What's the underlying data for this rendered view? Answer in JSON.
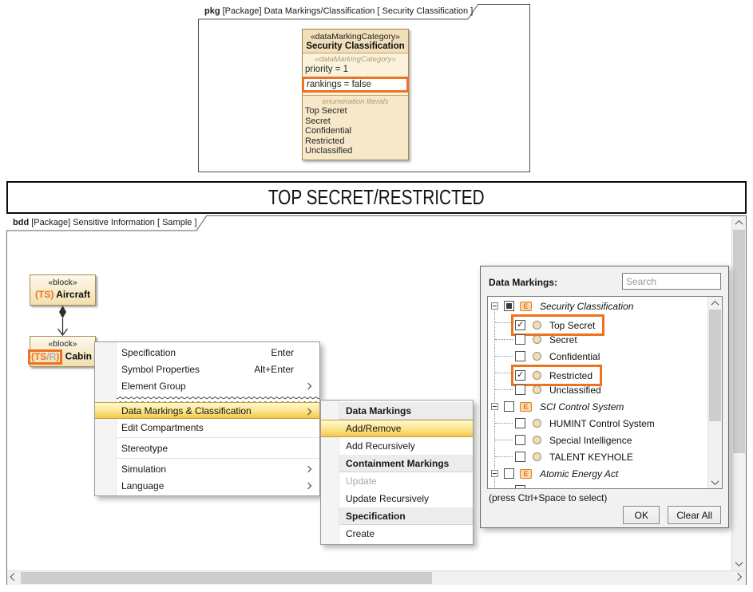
{
  "pkg_diagram": {
    "tab_kind": "pkg",
    "tab_title": "[Package] Data Markings/Classification [ Security Classification ]",
    "class_box": {
      "stereotype": "«dataMarkingCategory»",
      "name": "Security Classification",
      "section_stereotype": "«dataMarkingCategory»",
      "attribute_priority": "priority = 1",
      "attribute_rankings": "rankings = false",
      "literals_caption": "enumeration literals",
      "literals": [
        "Top Secret",
        "Secret",
        "Confidential",
        "Restricted",
        "Unclassified"
      ]
    }
  },
  "banner": {
    "text": "TOP SECRET/RESTRICTED"
  },
  "bdd_diagram": {
    "tab_kind": "bdd",
    "tab_title": "[Package] Sensitive Information [ Sample ]",
    "aircraft": {
      "stereotype": "«block»",
      "marking": "(TS)",
      "name": "Aircraft"
    },
    "cabin": {
      "stereotype": "«block»",
      "marking_ts": "(TS",
      "marking_r": "/R",
      "marking_close": ")",
      "name": "Cabin"
    }
  },
  "context_menu": {
    "items": [
      {
        "type": "item",
        "label": "Specification",
        "shortcut": "Enter"
      },
      {
        "type": "item",
        "label": "Symbol Properties",
        "shortcut": "Alt+Enter"
      },
      {
        "type": "item",
        "label": "Element Group",
        "submenu": true
      },
      {
        "type": "zigzag"
      },
      {
        "type": "item",
        "label": "Data Markings & Classification",
        "submenu": true,
        "highlighted": true
      },
      {
        "type": "item",
        "label": "Edit Compartments"
      },
      {
        "type": "separator"
      },
      {
        "type": "item",
        "label": "Stereotype"
      },
      {
        "type": "separator"
      },
      {
        "type": "item",
        "label": "Simulation",
        "submenu": true
      },
      {
        "type": "item",
        "label": "Language",
        "submenu": true
      }
    ]
  },
  "submenu": {
    "items": [
      {
        "type": "header",
        "label": "Data Markings"
      },
      {
        "type": "item",
        "label": "Add/Remove",
        "highlighted": true
      },
      {
        "type": "item",
        "label": "Add Recursively"
      },
      {
        "type": "header",
        "label": "Containment Markings"
      },
      {
        "type": "item",
        "label": "Update",
        "disabled": true
      },
      {
        "type": "item",
        "label": "Update Recursively"
      },
      {
        "type": "header",
        "label": "Specification"
      },
      {
        "type": "item",
        "label": "Create"
      }
    ]
  },
  "data_markings": {
    "title": "Data Markings:",
    "search_placeholder": "Search",
    "enum_icon_letter": "E",
    "tree": [
      {
        "label": "Security Classification",
        "kind": "category",
        "check": "partial"
      },
      {
        "label": "Top Secret",
        "kind": "literal",
        "check": "checked",
        "highlighted": true
      },
      {
        "label": "Secret",
        "kind": "literal",
        "check": "unchecked"
      },
      {
        "label": "Confidential",
        "kind": "literal",
        "check": "unchecked"
      },
      {
        "label": "Restricted",
        "kind": "literal",
        "check": "checked",
        "highlighted": true
      },
      {
        "label": "Unclassified",
        "kind": "literal",
        "check": "unchecked"
      },
      {
        "label": "SCI Control System",
        "kind": "category",
        "check": "unchecked"
      },
      {
        "label": "HUMINT Control System",
        "kind": "literal",
        "check": "unchecked"
      },
      {
        "label": "Special Intelligence",
        "kind": "literal",
        "check": "unchecked"
      },
      {
        "label": "TALENT KEYHOLE",
        "kind": "literal",
        "check": "unchecked"
      },
      {
        "label": "Atomic Energy Act",
        "kind": "category",
        "check": "unchecked"
      },
      {
        "label": "",
        "kind": "literal",
        "check": "unchecked",
        "partial": true
      }
    ],
    "hint": "(press Ctrl+Space to select)",
    "ok": "OK",
    "clear_all": "Clear All"
  },
  "colors": {
    "accent_orange": "#ee7220",
    "highlight_gold_top": "#fff8d2",
    "highlight_gold_bottom": "#f3c64b",
    "block_tan": "#f2dfae",
    "icon_tan": "#f6dcab"
  }
}
